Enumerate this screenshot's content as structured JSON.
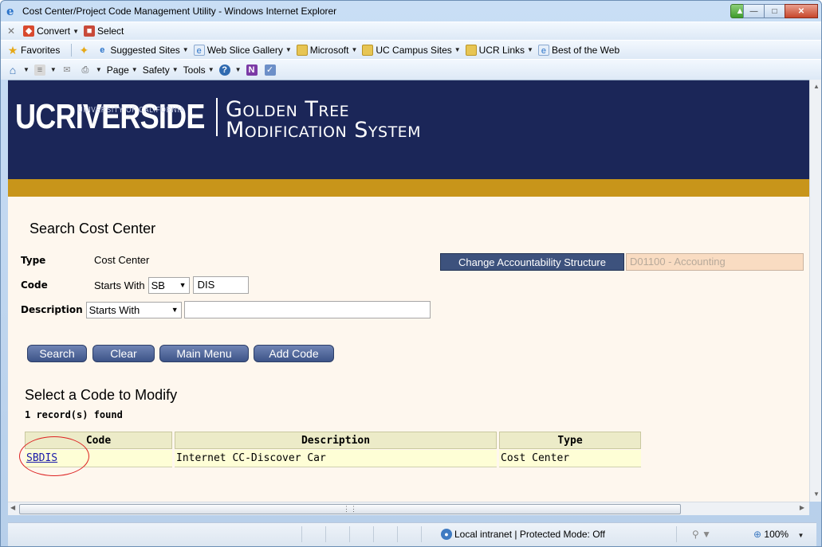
{
  "window": {
    "title": "Cost Center/Project Code Management Utility - Windows Internet Explorer"
  },
  "toolbar1": {
    "convert_label": "Convert",
    "select_label": "Select"
  },
  "favorites_bar": {
    "favorites_label": "Favorites",
    "items": [
      "Suggested Sites",
      "Web Slice Gallery",
      "Microsoft",
      "UC Campus Sites",
      "UCR Links",
      "Best of the Web"
    ]
  },
  "command_bar": {
    "page_label": "Page",
    "safety_label": "Safety",
    "tools_label": "Tools"
  },
  "header": {
    "logo_text": "UCRIVERSIDE",
    "logo_small": "UNIVERSITY OF CALIFORNIA",
    "system_line1": "Golden Tree",
    "system_line2": "Modification System"
  },
  "search": {
    "heading": "Search Cost Center",
    "type_label": "Type",
    "type_value": "Cost Center",
    "code_label": "Code",
    "code_operator_label": "Starts With",
    "code_prefix": "SB",
    "code_value": "DIS",
    "description_label": "Description",
    "description_operator": "Starts With",
    "description_value": "",
    "change_button": "Change Accountability Structure",
    "accountability_value": "D01100 - Accounting"
  },
  "buttons": {
    "search": "Search",
    "clear": "Clear",
    "main_menu": "Main Menu",
    "add_code": "Add Code"
  },
  "results": {
    "heading": "Select a Code to Modify",
    "count_text": "1 record(s) found",
    "columns": [
      "Code",
      "Description",
      "Type"
    ],
    "rows": [
      {
        "code": "SBDIS",
        "description": "Internet CC-Discover Car",
        "type": "Cost Center"
      }
    ]
  },
  "status_bar": {
    "zone_text": "Local intranet | Protected Mode: Off",
    "zoom_text": "100%"
  },
  "colors": {
    "header_navy": "#1b2658",
    "gold_bar": "#c8951a",
    "page_bg": "#fef7ee",
    "button_blue": "#3d5488"
  }
}
